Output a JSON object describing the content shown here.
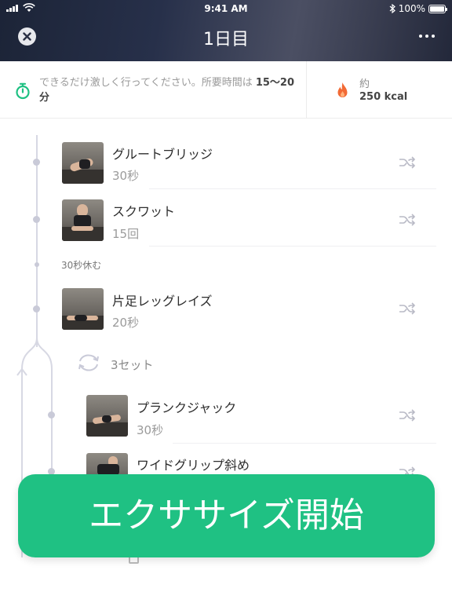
{
  "status_bar": {
    "time": "9:41 AM",
    "battery": "100%"
  },
  "nav": {
    "title": "1日目"
  },
  "info": {
    "instruction": "できるだけ激しく行ってください。所要時間は",
    "duration": "15〜20分",
    "calories_label": "約",
    "calories_value": "250 kcal"
  },
  "exercises": [
    {
      "name": "グルートブリッジ",
      "detail": "30秒"
    },
    {
      "name": "スクワット",
      "detail": "15回"
    },
    {
      "name": "片足レッグレイズ",
      "detail": "20秒"
    },
    {
      "name": "プランクジャック",
      "detail": "30秒"
    },
    {
      "name": "ワイドグリップ斜め",
      "detail": ""
    }
  ],
  "rest": {
    "label": "30秒休む"
  },
  "circuit": {
    "sets_label": "3セット"
  },
  "cta": {
    "start_label": "エクササイズ開始",
    "color": "#1fc183"
  },
  "icons": {
    "close": "close-icon",
    "more": "more-dots-icon",
    "timer": "stopwatch-icon",
    "calories": "flame-icon",
    "swap": "shuffle-icon",
    "repeat": "repeat-icon"
  }
}
